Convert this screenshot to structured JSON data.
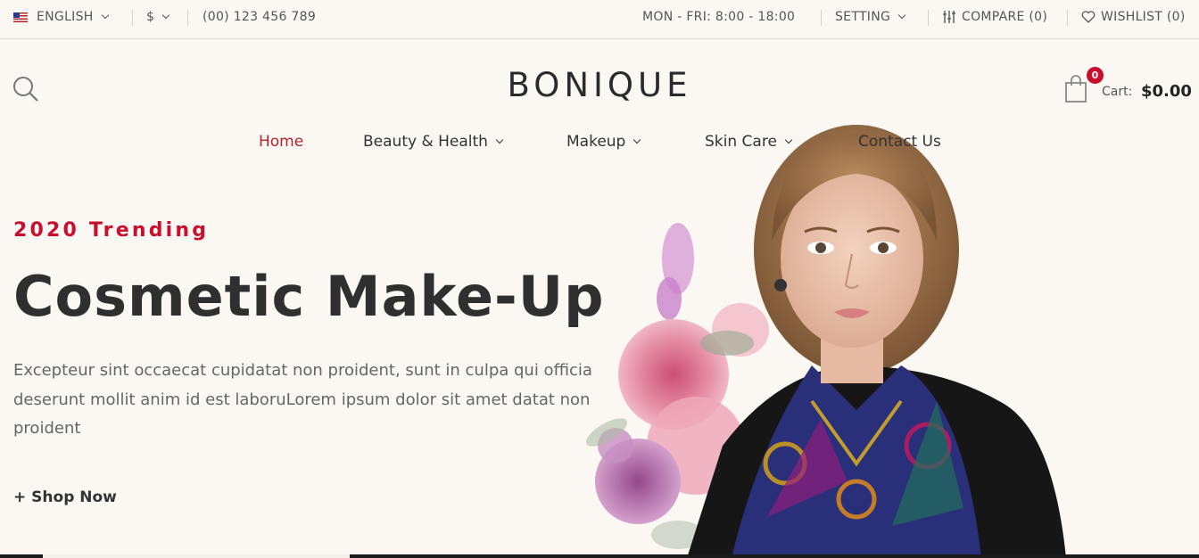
{
  "topbar": {
    "language": "ENGLISH",
    "currency": "$",
    "phone": "(00) 123 456 789",
    "hours": "MON - FRI: 8:00 - 18:00",
    "setting": "SETTING",
    "compare": "COMPARE (0)",
    "wishlist": "WISHLIST (0)"
  },
  "header": {
    "logo": "BONIQUE",
    "cart_count": "0",
    "cart_label": "Cart:",
    "cart_total": "$0.00"
  },
  "nav": {
    "items": [
      {
        "label": "Home",
        "active": true
      },
      {
        "label": "Beauty & Health",
        "dropdown": true
      },
      {
        "label": "Makeup",
        "dropdown": true
      },
      {
        "label": "Skin Care",
        "dropdown": true
      },
      {
        "label": "Contact Us"
      }
    ]
  },
  "hero": {
    "eyebrow": "2020 Trending",
    "headline": "Cosmetic Make-Up",
    "description": "Excepteur sint occaecat cupidatat non proident, sunt in culpa qui officia deserunt mollit anim id est laboruLorem ipsum dolor sit amet datat non proident",
    "cta": "+ Shop Now"
  },
  "colors": {
    "background": "#fbf7f2",
    "accent": "#c8102e",
    "text": "#333333"
  },
  "icons": [
    "us-flag-icon",
    "search-icon",
    "cart-icon",
    "compare-icon",
    "heart-icon"
  ]
}
